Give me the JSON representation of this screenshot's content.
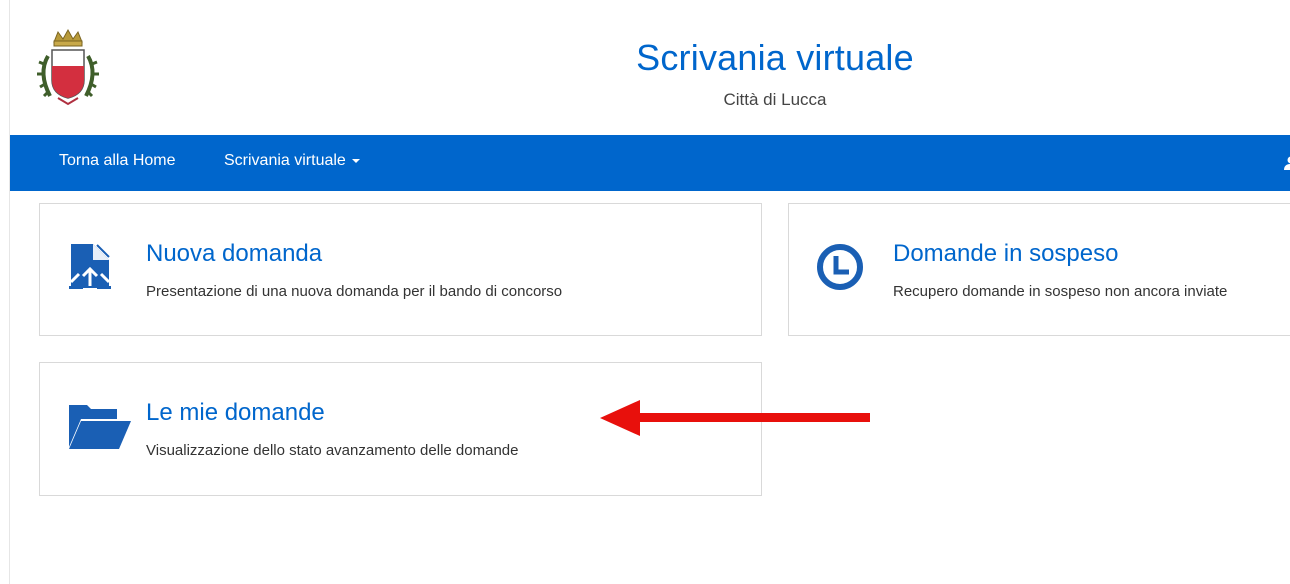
{
  "header": {
    "title": "Scrivania virtuale",
    "subtitle": "Città di Lucca"
  },
  "navbar": {
    "home_label": "Torna alla Home",
    "scrivania_label": "Scrivania virtuale",
    "background": "#0066cc"
  },
  "cards": [
    {
      "icon": "document-upload-icon",
      "title": "Nuova domanda",
      "description": "Presentazione di una nuova domanda per il bando di concorso"
    },
    {
      "icon": "clock-icon",
      "title": "Domande in sospeso",
      "description": "Recupero domande in sospeso non ancora inviate"
    },
    {
      "icon": "folder-open-icon",
      "title": "Le mie domande",
      "description": "Visualizzazione dello stato avanzamento delle domande"
    }
  ],
  "annotation": {
    "icon": "arrow-left-icon",
    "color": "#e8100c"
  },
  "colors": {
    "accent": "#0066cc",
    "text": "#333333"
  }
}
